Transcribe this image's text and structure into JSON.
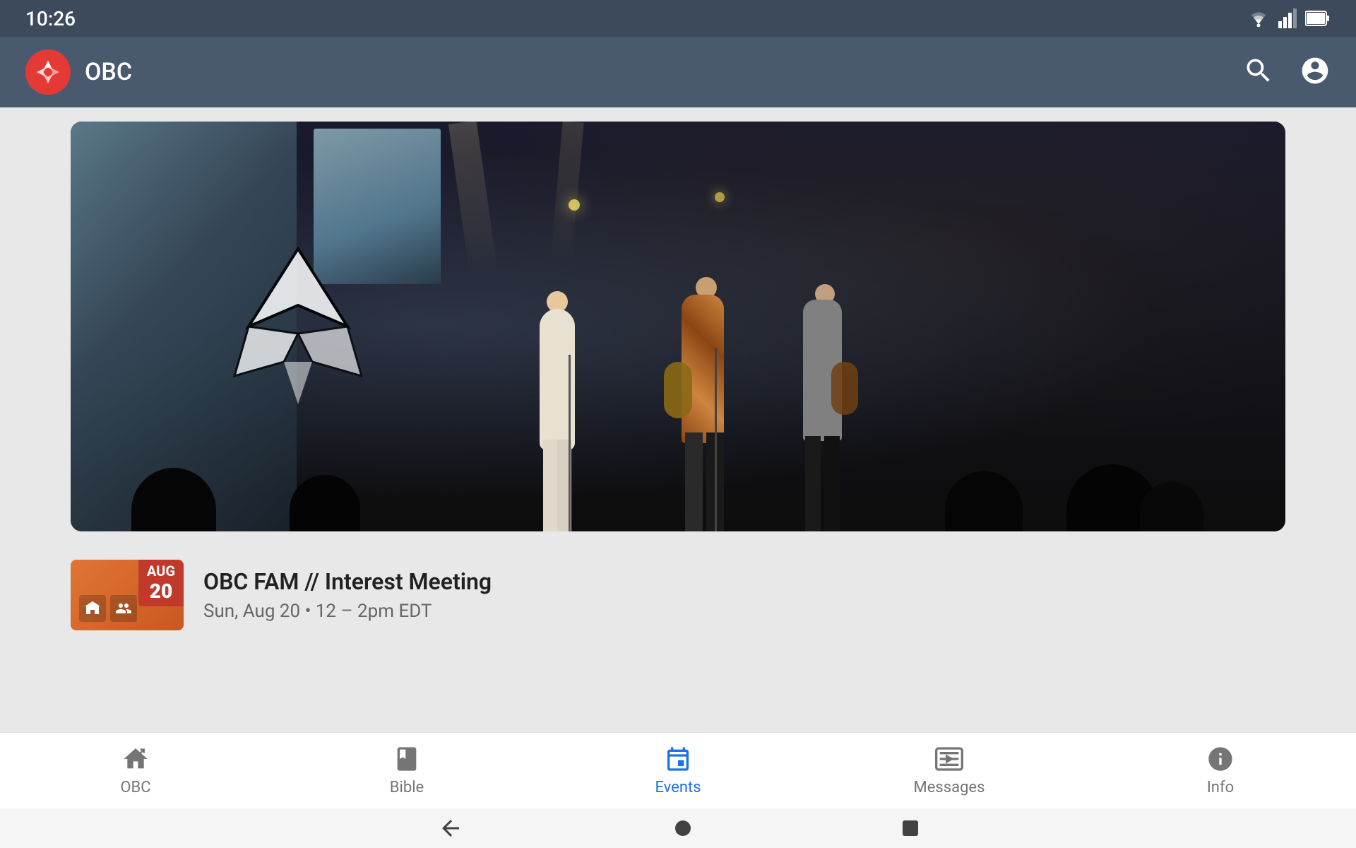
{
  "statusBar": {
    "time": "10:26"
  },
  "appBar": {
    "title": "OBC",
    "searchLabel": "search",
    "profileLabel": "profile"
  },
  "heroVideo": {
    "altText": "Church worship band on stage"
  },
  "events": {
    "items": [
      {
        "title": "OBC FAM // Interest Meeting",
        "dateMonth": "AUG",
        "dateDay": "20",
        "time": "Sun, Aug 20 • 12 – 2pm EDT"
      }
    ]
  },
  "bottomNav": {
    "items": [
      {
        "id": "obc",
        "label": "OBC",
        "icon": "home-icon",
        "active": false
      },
      {
        "id": "bible",
        "label": "Bible",
        "icon": "bible-icon",
        "active": false
      },
      {
        "id": "events",
        "label": "Events",
        "icon": "events-icon",
        "active": true
      },
      {
        "id": "messages",
        "label": "Messages",
        "icon": "messages-icon",
        "active": false
      },
      {
        "id": "info",
        "label": "Info",
        "icon": "info-icon",
        "active": false
      }
    ]
  },
  "systemNav": {
    "back": "back",
    "home": "home",
    "recents": "recents"
  }
}
